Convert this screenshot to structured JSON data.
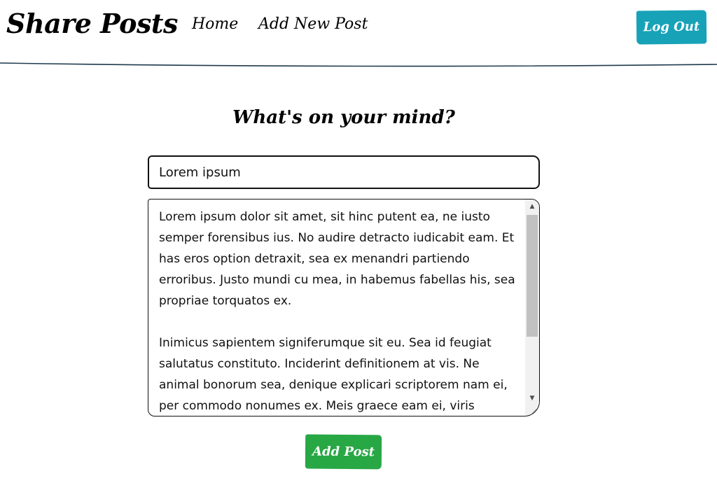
{
  "header": {
    "brand": "Share Posts",
    "nav": {
      "home": "Home",
      "add_new_post": "Add New Post"
    },
    "logout_label": "Log Out"
  },
  "form": {
    "heading": "What's on your mind?",
    "title_value": "Lorem ipsum",
    "body_value": "Lorem ipsum dolor sit amet, sit hinc putent ea, ne iusto semper forensibus ius. No audire detracto iudicabit eam. Et has eros option detraxit, sea ex menandri partiendo erroribus. Justo mundi cu mea, in habemus fabellas his, sea propriae torquatos ex.\n\nInimicus sapientem signiferumque sit eu. Sea id feugiat salutatus constituto. Inciderint definitionem at vis. Ne animal bonorum sea, denique explicari scriptorem nam ei, per commodo nonumes ex. Meis graece eam ei, viris",
    "submit_label": "Add Post"
  },
  "colors": {
    "logout_bg": "#17a2b8",
    "submit_bg": "#28a745",
    "header_line": "#1f3a4d"
  },
  "icons": {
    "scroll_up": "scroll-up-arrow-icon",
    "scroll_down": "scroll-down-arrow-icon",
    "resize": "resize-grip-icon"
  }
}
